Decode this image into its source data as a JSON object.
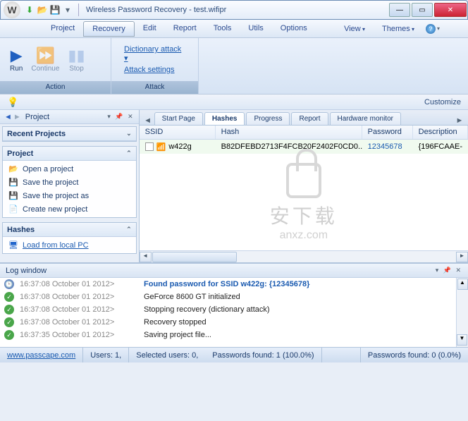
{
  "window": {
    "title": "Wireless Password Recovery - test.wifipr"
  },
  "menubar": {
    "items": [
      "Project",
      "Recovery",
      "Edit",
      "Report",
      "Tools",
      "Utils",
      "Options"
    ],
    "active": 1,
    "right": [
      "View",
      "Themes"
    ]
  },
  "ribbon": {
    "action": {
      "label": "Action",
      "run": "Run",
      "continue": "Continue",
      "stop": "Stop"
    },
    "attack": {
      "label": "Attack",
      "method": "Dictionary attack",
      "settings": "Attack settings"
    }
  },
  "customize": "Customize",
  "left": {
    "title": "Project",
    "recent": "Recent Projects",
    "project_section": "Project",
    "items": [
      {
        "icon": "📂",
        "label": "Open a project"
      },
      {
        "icon": "💾",
        "label": "Save the project"
      },
      {
        "icon": "💾",
        "label": "Save the project as"
      },
      {
        "icon": "📄",
        "label": "Create new project"
      }
    ],
    "hashes_section": "Hashes",
    "hashes_link": "Load from local PC"
  },
  "tabs": {
    "items": [
      "Start Page",
      "Hashes",
      "Progress",
      "Report",
      "Hardware monitor"
    ],
    "active": 1
  },
  "grid": {
    "cols": {
      "ssid": "SSID",
      "hash": "Hash",
      "pass": "Password",
      "desc": "Description"
    },
    "rows": [
      {
        "ssid": "w422g",
        "hash": "B82DFEBD2713F4FCB20F2402F0CD0...",
        "pass": "12345678",
        "desc": "{196FCAAE-"
      }
    ]
  },
  "watermark": {
    "cn": "安下载",
    "en": "anxz.com"
  },
  "log": {
    "title": "Log window",
    "rows": [
      {
        "type": "clock",
        "ts": "16:37:08 October 01 2012>",
        "msg": "Found password for SSID w422g: {12345678}",
        "cls": "found"
      },
      {
        "type": "ok",
        "ts": "16:37:08 October 01 2012>",
        "msg": "GeForce 8600 GT initialized"
      },
      {
        "type": "ok",
        "ts": "16:37:08 October 01 2012>",
        "msg": "Stopping recovery (dictionary attack)"
      },
      {
        "type": "ok",
        "ts": "16:37:08 October 01 2012>",
        "msg": "Recovery stopped"
      },
      {
        "type": "ok",
        "ts": "16:37:35 October 01 2012>",
        "msg": "Saving project file..."
      }
    ]
  },
  "status": {
    "url": "www.passcape.com",
    "users": "Users: 1,",
    "selected": "Selected users: 0,",
    "found": "Passwords found: 1 (100.0%)",
    "found2": "Passwords found: 0 (0.0%)"
  }
}
